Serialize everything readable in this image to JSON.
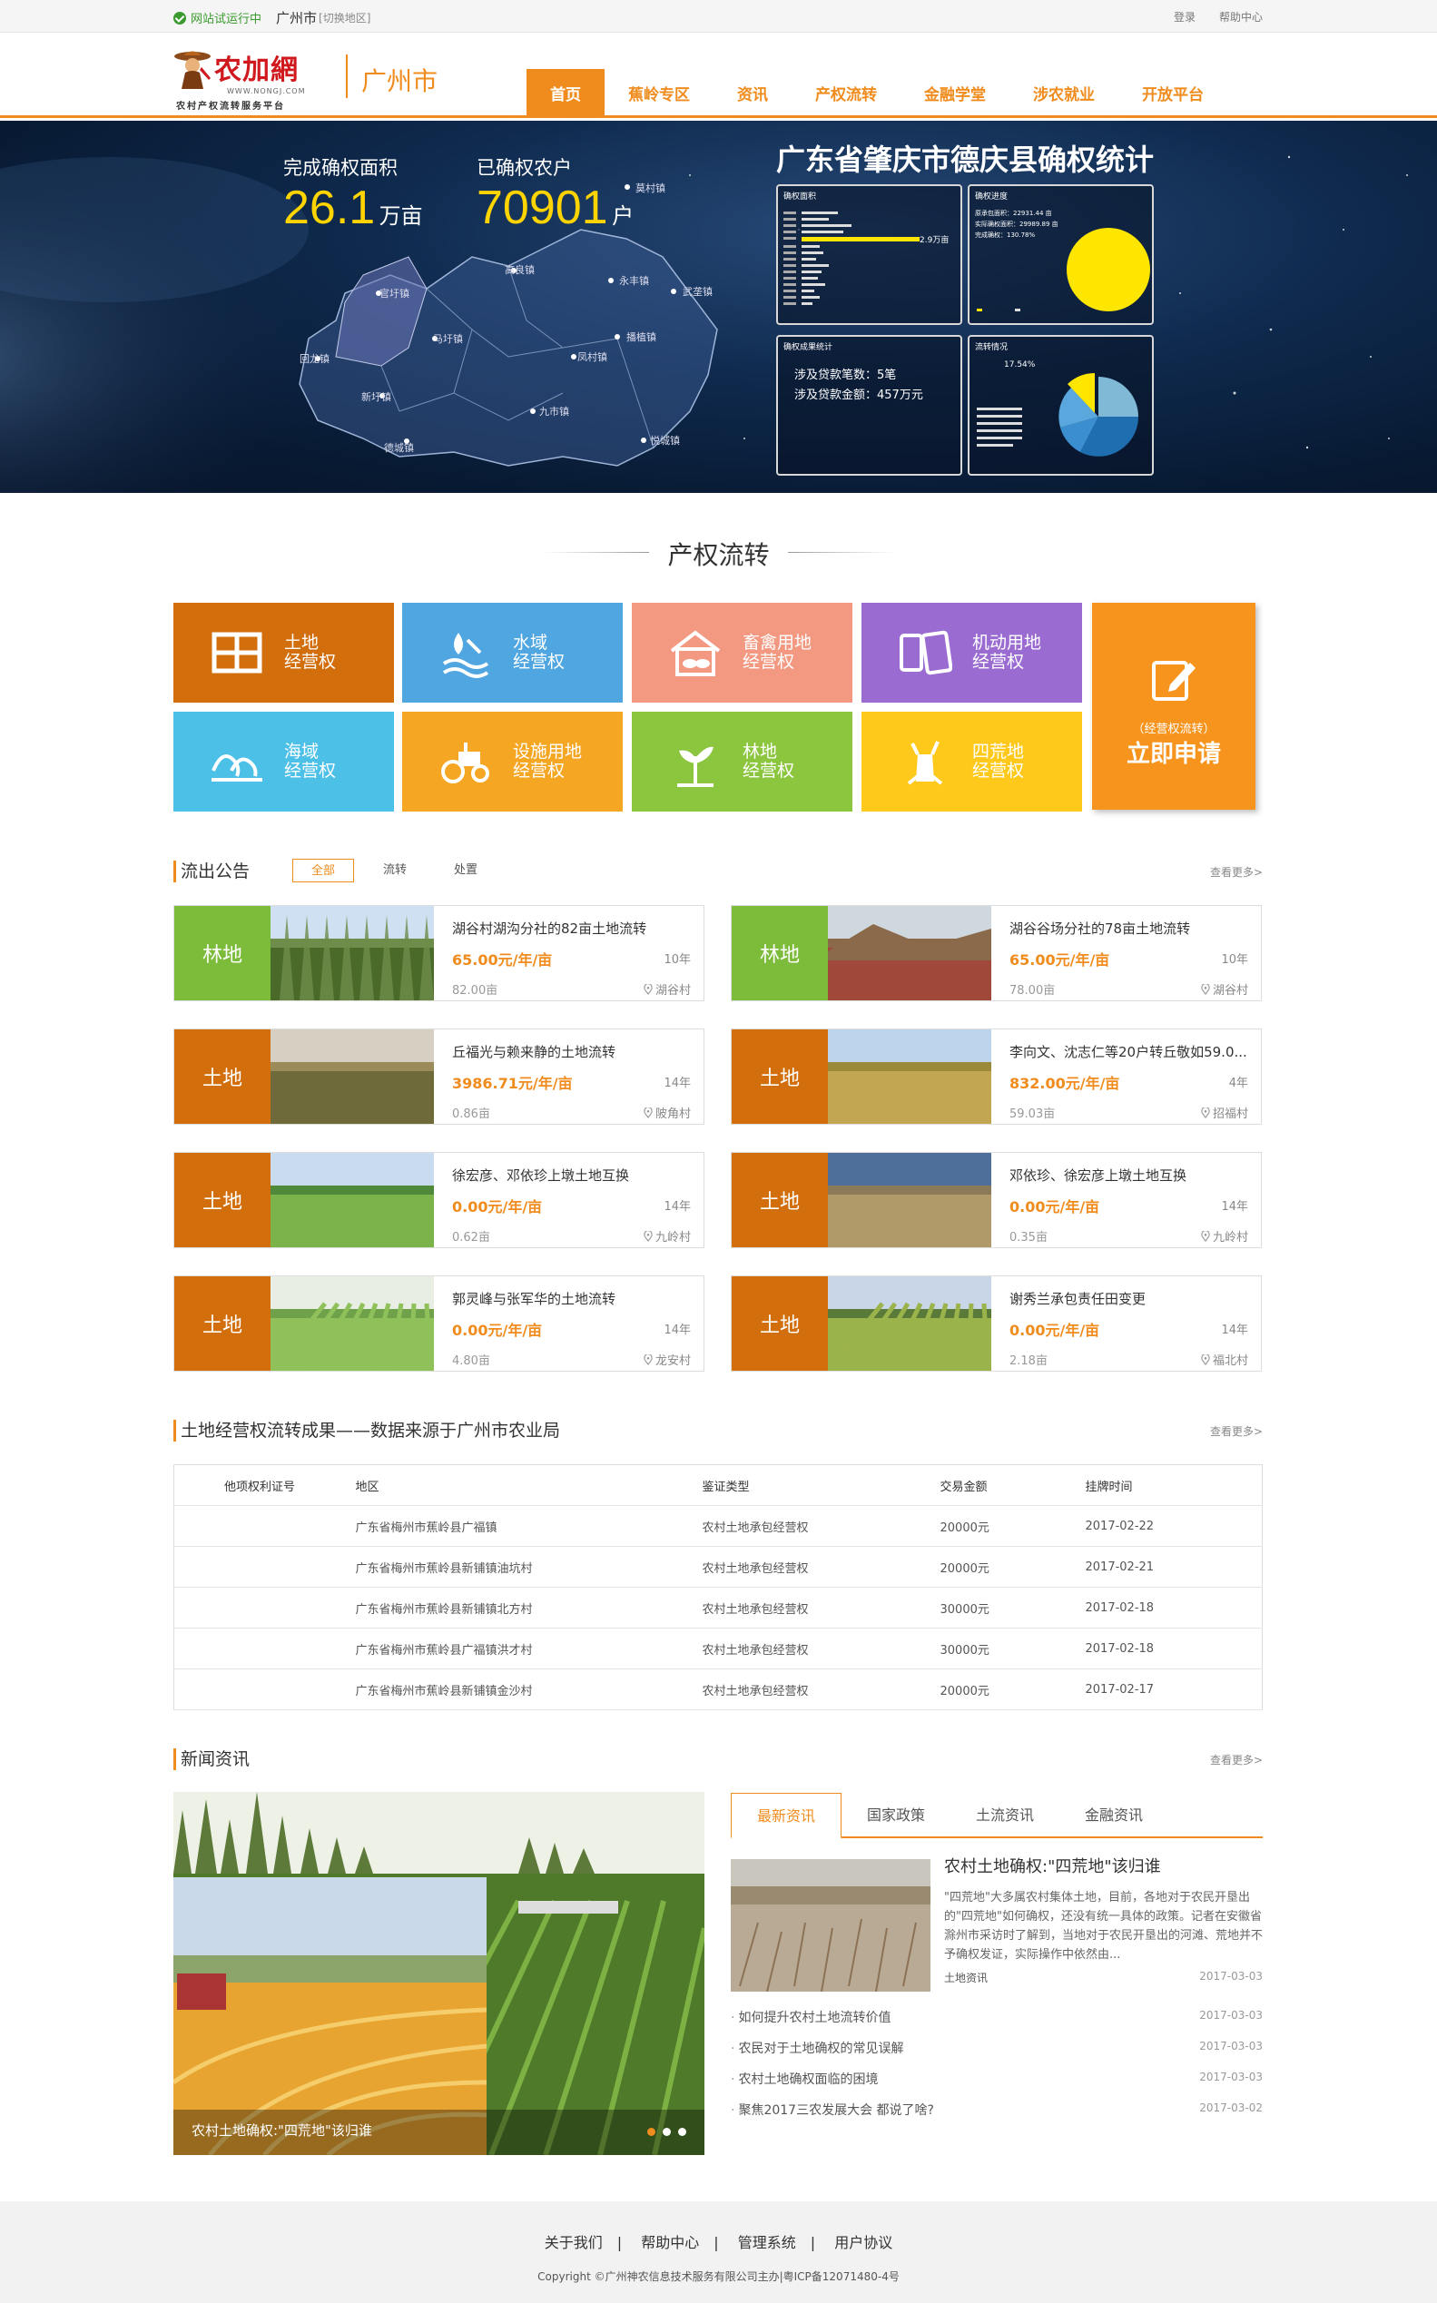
{
  "topbar": {
    "status": "网站试运行中",
    "city": "广州市",
    "switch": "[切换地区]",
    "login": "登录",
    "help": "帮助中心"
  },
  "header": {
    "logo_name": "农加網",
    "logo_url": "WWW.NONGJ.COM",
    "logo_sub": "农村产权流转服务平台",
    "city": "广州市",
    "nav": [
      "首页",
      "蕉岭专区",
      "资讯",
      "产权流转",
      "金融学堂",
      "涉农就业",
      "开放平台"
    ]
  },
  "banner": {
    "area_label": "完成确权面积",
    "area_value": "26.1",
    "area_unit": "万亩",
    "farmers_label": "已确权农户",
    "farmers_value": "70901",
    "farmers_unit": "户",
    "title": "广东省肇庆市德庆县确权统计",
    "towns": [
      "莫村镇",
      "高良镇",
      "永丰镇",
      "武垄镇",
      "官圩镇",
      "马圩镇",
      "播植镇",
      "凤村镇",
      "回龙镇",
      "新圩镇",
      "九市镇",
      "悦城镇",
      "德城镇"
    ],
    "panel1_title": "确权面积",
    "panel1_value": "2.9万亩",
    "panel2_title": "确权进度",
    "panel2_lines": [
      "原承包面积：22931.44 亩",
      "实际确权面积：29989.89 亩",
      "完成确权：130.78%"
    ],
    "panel3_title": "确权成果统计",
    "loan_count_label": "涉及贷款笔数：",
    "loan_count": "5笔",
    "loan_amount_label": "涉及贷款金额：",
    "loan_amount": "457万元",
    "panel4_title": "流转情况",
    "panel4_pct": "17.54%"
  },
  "section": {
    "title": "产权流转"
  },
  "tiles": [
    {
      "label1": "土地",
      "label2": "经营权",
      "color": "#d26e0b",
      "icon": "grid-icon"
    },
    {
      "label1": "水域",
      "label2": "经营权",
      "color": "#4fa6e0",
      "icon": "water-icon"
    },
    {
      "label1": "畜禽用地",
      "label2": "经营权",
      "color": "#f39881",
      "icon": "livestock-icon"
    },
    {
      "label1": "机动用地",
      "label2": "经营权",
      "color": "#9a6bd1",
      "icon": "cards-icon"
    },
    {
      "label1": "海域",
      "label2": "经营权",
      "color": "#4dc0e8",
      "icon": "wave-icon"
    },
    {
      "label1": "设施用地",
      "label2": "经营权",
      "color": "#f5a623",
      "icon": "tractor-icon"
    },
    {
      "label1": "林地",
      "label2": "经营权",
      "color": "#8cc63f",
      "icon": "tree-icon"
    },
    {
      "label1": "四荒地",
      "label2": "经营权",
      "color": "#ffc91c",
      "icon": "stump-icon"
    }
  ],
  "apply": {
    "small": "（经营权流转）",
    "big": "立即申请"
  },
  "outflow": {
    "title": "流出公告",
    "more": "查看更多>",
    "tabs": [
      "全部",
      "流转",
      "处置"
    ],
    "items": [
      {
        "tag": "林地",
        "title": "湖谷村湖沟分社的82亩土地流转",
        "price": "65.00元/年/亩",
        "years": "10年",
        "area": "82.00亩",
        "loc": "湖谷村"
      },
      {
        "tag": "林地",
        "title": "湖谷谷场分社的78亩土地流转",
        "price": "65.00元/年/亩",
        "years": "10年",
        "area": "78.00亩",
        "loc": "湖谷村"
      },
      {
        "tag": "土地",
        "title": "丘福光与赖来静的土地流转",
        "price": "3986.71元/年/亩",
        "years": "14年",
        "area": "0.86亩",
        "loc": "陂角村"
      },
      {
        "tag": "土地",
        "title": "李向文、沈志仁等20户转丘敬如59.0...",
        "price": "832.00元/年/亩",
        "years": "4年",
        "area": "59.03亩",
        "loc": "招福村"
      },
      {
        "tag": "土地",
        "title": "徐宏彦、邓依珍上墩土地互换",
        "price": "0.00元/年/亩",
        "years": "14年",
        "area": "0.62亩",
        "loc": "九岭村"
      },
      {
        "tag": "土地",
        "title": "邓依珍、徐宏彦上墩土地互换",
        "price": "0.00元/年/亩",
        "years": "14年",
        "area": "0.35亩",
        "loc": "九岭村"
      },
      {
        "tag": "土地",
        "title": "郭灵峰与张军华的土地流转",
        "price": "0.00元/年/亩",
        "years": "14年",
        "area": "4.80亩",
        "loc": "龙安村"
      },
      {
        "tag": "土地",
        "title": "谢秀兰承包责任田变更",
        "price": "0.00元/年/亩",
        "years": "14年",
        "area": "2.18亩",
        "loc": "福北村"
      }
    ]
  },
  "results": {
    "title": "土地经营权流转成果——数据来源于广州市农业局",
    "more": "查看更多>",
    "headers": [
      "他项权利证号",
      "地区",
      "鉴证类型",
      "交易金额",
      "挂牌时间"
    ],
    "rows": [
      [
        "",
        "广东省梅州市蕉岭县广福镇",
        "农村土地承包经营权",
        "20000元",
        "2017-02-22"
      ],
      [
        "",
        "广东省梅州市蕉岭县新铺镇油坑村",
        "农村土地承包经营权",
        "20000元",
        "2017-02-21"
      ],
      [
        "",
        "广东省梅州市蕉岭县新铺镇北方村",
        "农村土地承包经营权",
        "30000元",
        "2017-02-18"
      ],
      [
        "",
        "广东省梅州市蕉岭县广福镇洪才村",
        "农村土地承包经营权",
        "30000元",
        "2017-02-18"
      ],
      [
        "",
        "广东省梅州市蕉岭县新铺镇金沙村",
        "农村土地承包经营权",
        "20000元",
        "2017-02-17"
      ]
    ]
  },
  "news": {
    "title": "新闻资讯",
    "more": "查看更多>",
    "slide_caption": "农村土地确权:\"四荒地\"该归谁",
    "tabs": [
      "最新资讯",
      "国家政策",
      "土流资讯",
      "金融资讯"
    ],
    "headline": "农村土地确权:\"四荒地\"该归谁",
    "summary": "\"四荒地\"大多属农村集体土地，目前，各地对于农民开垦出的\"四荒地\"如何确权，还没有统一具体的政策。记者在安徽省滁州市采访时了解到，当地对于农民开垦出的河滩、荒地并不予确权发证，实际操作中依然由...",
    "category": "土地资讯",
    "headline_date": "2017-03-03",
    "items": [
      {
        "title": "如何提升农村土地流转价值",
        "date": "2017-03-03"
      },
      {
        "title": "农民对于土地确权的常见误解",
        "date": "2017-03-03"
      },
      {
        "title": "农村土地确权面临的困境",
        "date": "2017-03-03"
      },
      {
        "title": "聚焦2017三农发展大会 都说了啥?",
        "date": "2017-03-02"
      }
    ]
  },
  "footer": {
    "links": [
      "关于我们",
      "帮助中心",
      "管理系统",
      "用户协议"
    ],
    "copyright": "Copyright ©广州神农信息技术服务有限公司主办|粤ICP备12071480-4号"
  }
}
